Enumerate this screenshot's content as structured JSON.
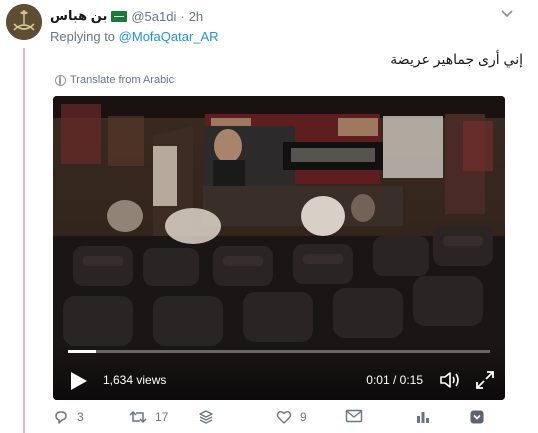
{
  "tweet": {
    "author_name": "بن هباس",
    "handle": "@5a1di",
    "separator": "·",
    "time": "2h",
    "replying_prefix": "Replying to",
    "replying_to": "@MofaQatar_AR",
    "text": "إني أرى جماهير عريضة",
    "translate_label": "Translate from Arabic"
  },
  "video": {
    "views": "1,634 views",
    "time": "0:01 / 0:15",
    "progress": 0.067
  },
  "actions": {
    "replies": "3",
    "retweets": "17",
    "likes": "9"
  },
  "colors": {
    "link": "#1b95e0",
    "muted": "#657786",
    "thread_line": "#e2b8c4"
  }
}
